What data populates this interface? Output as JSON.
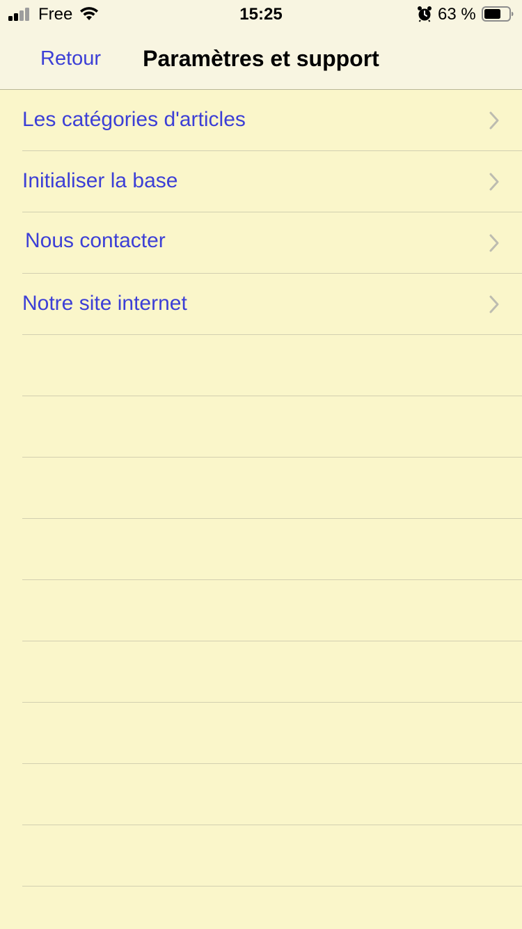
{
  "status_bar": {
    "carrier": "Free",
    "time": "15:25",
    "battery_percent": "63 %",
    "signal_bars": 2,
    "icons": [
      "signal-icon",
      "wifi-icon",
      "alarm-icon",
      "battery-icon"
    ]
  },
  "nav": {
    "back_label": "Retour",
    "title": "Paramètres et support"
  },
  "list": {
    "items": [
      {
        "label": "Les catégories d'articles"
      },
      {
        "label": "Initialiser la base"
      },
      {
        "label": "Nous contacter"
      },
      {
        "label": "Notre site internet"
      }
    ]
  },
  "colors": {
    "background": "#faf6ca",
    "bar_background": "#f8f5e1",
    "accent": "#3c3fd6",
    "separator": "#d2cfb0",
    "chevron": "#bdbcb0"
  }
}
